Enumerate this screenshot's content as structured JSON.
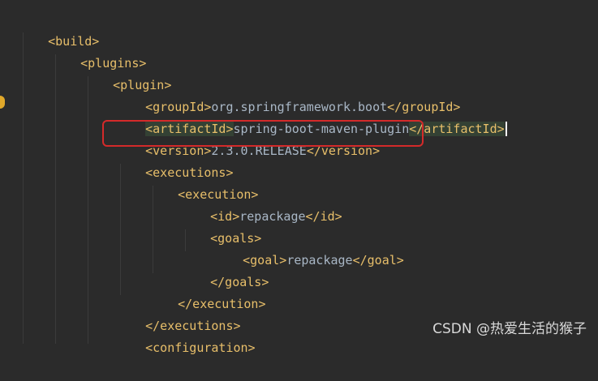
{
  "code_lines": [
    {
      "open": "<build>"
    },
    {
      "open": "<plugins>"
    },
    {
      "open": "<plugin>"
    },
    {
      "open": "<groupId>",
      "text": "org.springframework.boot",
      "close": "</groupId>"
    },
    {
      "open": "<artifactId>",
      "text": "spring-boot-maven-plugin",
      "close": "</artifactId>"
    },
    {
      "open": "<version>",
      "text": "2.3.0.RELEASE",
      "close": "</version>"
    },
    {
      "open": "<executions>"
    },
    {
      "open": "<execution>"
    },
    {
      "open": "<id>",
      "text": "repackage",
      "close": "</id>"
    },
    {
      "open": "<goals>"
    },
    {
      "open": "<goal>",
      "text": "repackage",
      "close": "</goal>"
    },
    {
      "open": "</goals>"
    },
    {
      "open": "</execution>"
    },
    {
      "open": "</executions>"
    },
    {
      "open": "<configuration>"
    }
  ],
  "watermark": "CSDN @热爱生活的猴子",
  "colors": {
    "background": "#2b2b2b",
    "tag": "#e8bf6a",
    "text": "#a9b7c6",
    "highlight_box": "#d42a2a"
  }
}
